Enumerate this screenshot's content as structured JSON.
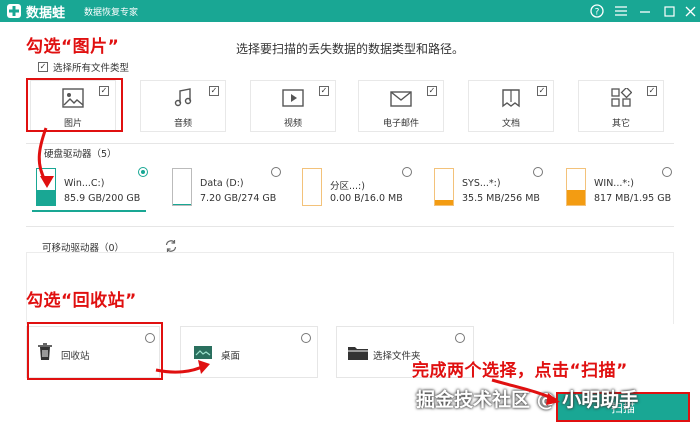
{
  "app": {
    "name": "数据蛙",
    "subtitle": "数据恢复专家"
  },
  "instruction": "选择要扫描的丢失数据的数据类型和路径。",
  "annotations": {
    "step1": "勾选“图片”",
    "step2": "勾选“回收站”",
    "step3": "完成两个选择，点击“扫描”"
  },
  "select_all": {
    "label": "选择所有文件类型",
    "checked": true
  },
  "file_types": [
    {
      "label": "图片",
      "icon": "image-icon",
      "checked": true
    },
    {
      "label": "音频",
      "icon": "music-icon",
      "checked": true
    },
    {
      "label": "视频",
      "icon": "video-icon",
      "checked": true
    },
    {
      "label": "电子邮件",
      "icon": "email-icon",
      "checked": true
    },
    {
      "label": "文档",
      "icon": "document-icon",
      "checked": true
    },
    {
      "label": "其它",
      "icon": "others-icon",
      "checked": true
    }
  ],
  "hard_drives": {
    "title": "硬盘驱动器（5）",
    "items": [
      {
        "name": "Win...C:)",
        "size": "85.9 GB/200 GB",
        "fill": 0.43,
        "selected": true
      },
      {
        "name": "Data (D:)",
        "size": "7.20 GB/274 GB",
        "fill": 0.03,
        "selected": false
      },
      {
        "name": "分区...:)",
        "size": "0.00  B/16.0 MB",
        "fill": 0.0,
        "selected": false
      },
      {
        "name": "SYS...*:)",
        "size": "35.5 MB/256 MB",
        "fill": 0.14,
        "selected": false
      },
      {
        "name": "WIN...*:)",
        "size": "817 MB/1.95 GB",
        "fill": 0.42,
        "selected": false
      }
    ]
  },
  "removable": {
    "title": "可移动驱动器（0）"
  },
  "locations": [
    {
      "label": "回收站",
      "icon": "recycle-bin-icon"
    },
    {
      "label": "桌面",
      "icon": "desktop-icon"
    },
    {
      "label": "选择文件夹",
      "icon": "folder-icon"
    }
  ],
  "scan_button": "扫描",
  "watermark": "掘金技术社区 @ 小明助手",
  "colors": {
    "accent": "#19a794",
    "annotation": "#e01010",
    "drive_orange": "#f39c12"
  }
}
